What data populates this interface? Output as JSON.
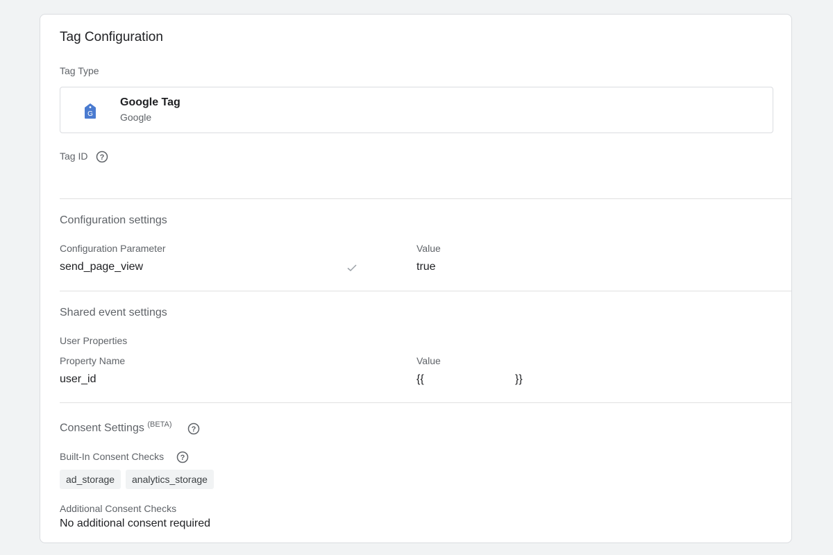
{
  "card": {
    "title": "Tag Configuration",
    "tag_type_label": "Tag Type",
    "tag": {
      "name": "Google Tag",
      "vendor": "Google",
      "icon": "google-tag-icon",
      "icon_color": "#4a7bd0",
      "icon_letter": "G"
    },
    "tag_id_label": "Tag ID",
    "help_icon": "question-circle-icon"
  },
  "configuration_settings": {
    "heading": "Configuration settings",
    "param_header": "Configuration Parameter",
    "value_header": "Value",
    "rows": [
      {
        "parameter": "send_page_view",
        "value": "true",
        "checked_icon": "check-icon"
      }
    ]
  },
  "shared_event_settings": {
    "heading": "Shared event settings",
    "user_properties_label": "User Properties",
    "name_header": "Property Name",
    "value_header": "Value",
    "rows": [
      {
        "name": "user_id",
        "value_open": "{{",
        "value_close": "}}"
      }
    ]
  },
  "consent_settings": {
    "heading": "Consent Settings",
    "beta": "(BETA)",
    "builtin_label": "Built-In Consent Checks",
    "builtin_checks": [
      "ad_storage",
      "analytics_storage"
    ],
    "additional_label": "Additional Consent Checks",
    "additional_value": "No additional consent required"
  }
}
